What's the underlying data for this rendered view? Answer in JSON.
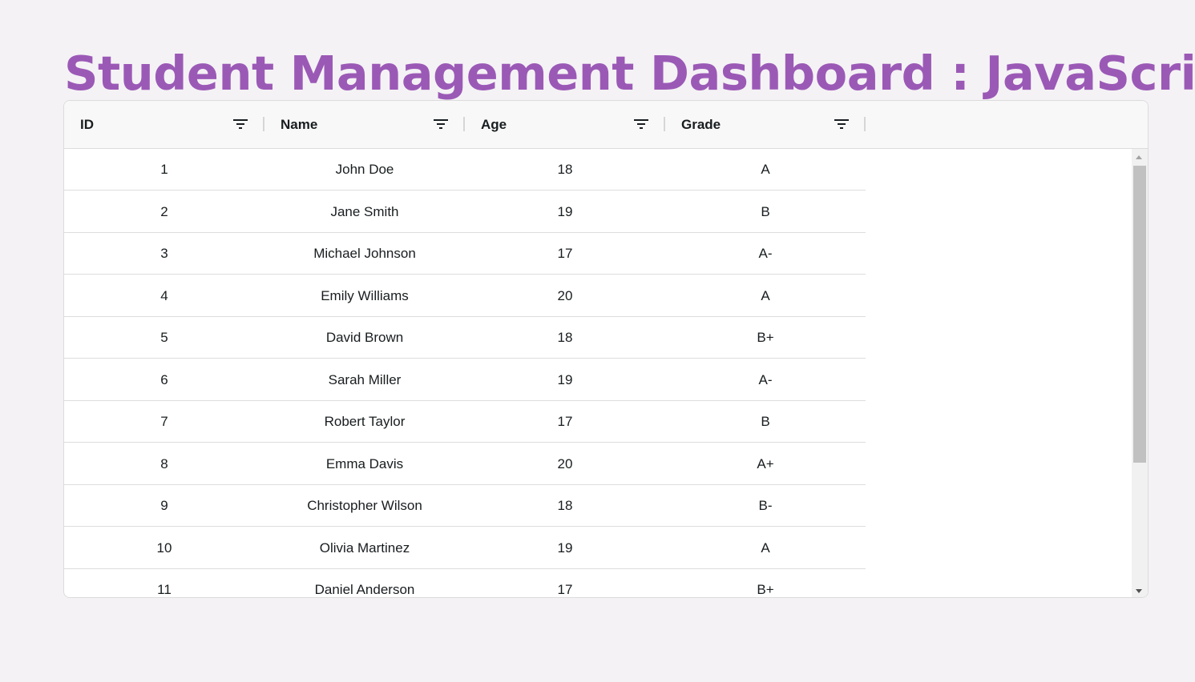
{
  "page": {
    "title": "Student Management Dashboard : JavaScript",
    "title_color": "#9b59b6",
    "background": "#f4f2f5"
  },
  "grid": {
    "columns": [
      {
        "label": "ID",
        "icon": "filter-icon"
      },
      {
        "label": "Name",
        "icon": "filter-icon"
      },
      {
        "label": "Age",
        "icon": "filter-icon"
      },
      {
        "label": "Grade",
        "icon": "filter-icon"
      }
    ],
    "rows": [
      {
        "id": "1",
        "name": "John Doe",
        "age": "18",
        "grade": "A"
      },
      {
        "id": "2",
        "name": "Jane Smith",
        "age": "19",
        "grade": "B"
      },
      {
        "id": "3",
        "name": "Michael Johnson",
        "age": "17",
        "grade": "A-"
      },
      {
        "id": "4",
        "name": "Emily Williams",
        "age": "20",
        "grade": "A"
      },
      {
        "id": "5",
        "name": "David Brown",
        "age": "18",
        "grade": "B+"
      },
      {
        "id": "6",
        "name": "Sarah Miller",
        "age": "19",
        "grade": "A-"
      },
      {
        "id": "7",
        "name": "Robert Taylor",
        "age": "17",
        "grade": "B"
      },
      {
        "id": "8",
        "name": "Emma Davis",
        "age": "20",
        "grade": "A+"
      },
      {
        "id": "9",
        "name": "Christopher Wilson",
        "age": "18",
        "grade": "B-"
      },
      {
        "id": "10",
        "name": "Olivia Martinez",
        "age": "19",
        "grade": "A"
      },
      {
        "id": "11",
        "name": "Daniel Anderson",
        "age": "17",
        "grade": "B+"
      }
    ],
    "scrollbar_position": 0
  }
}
